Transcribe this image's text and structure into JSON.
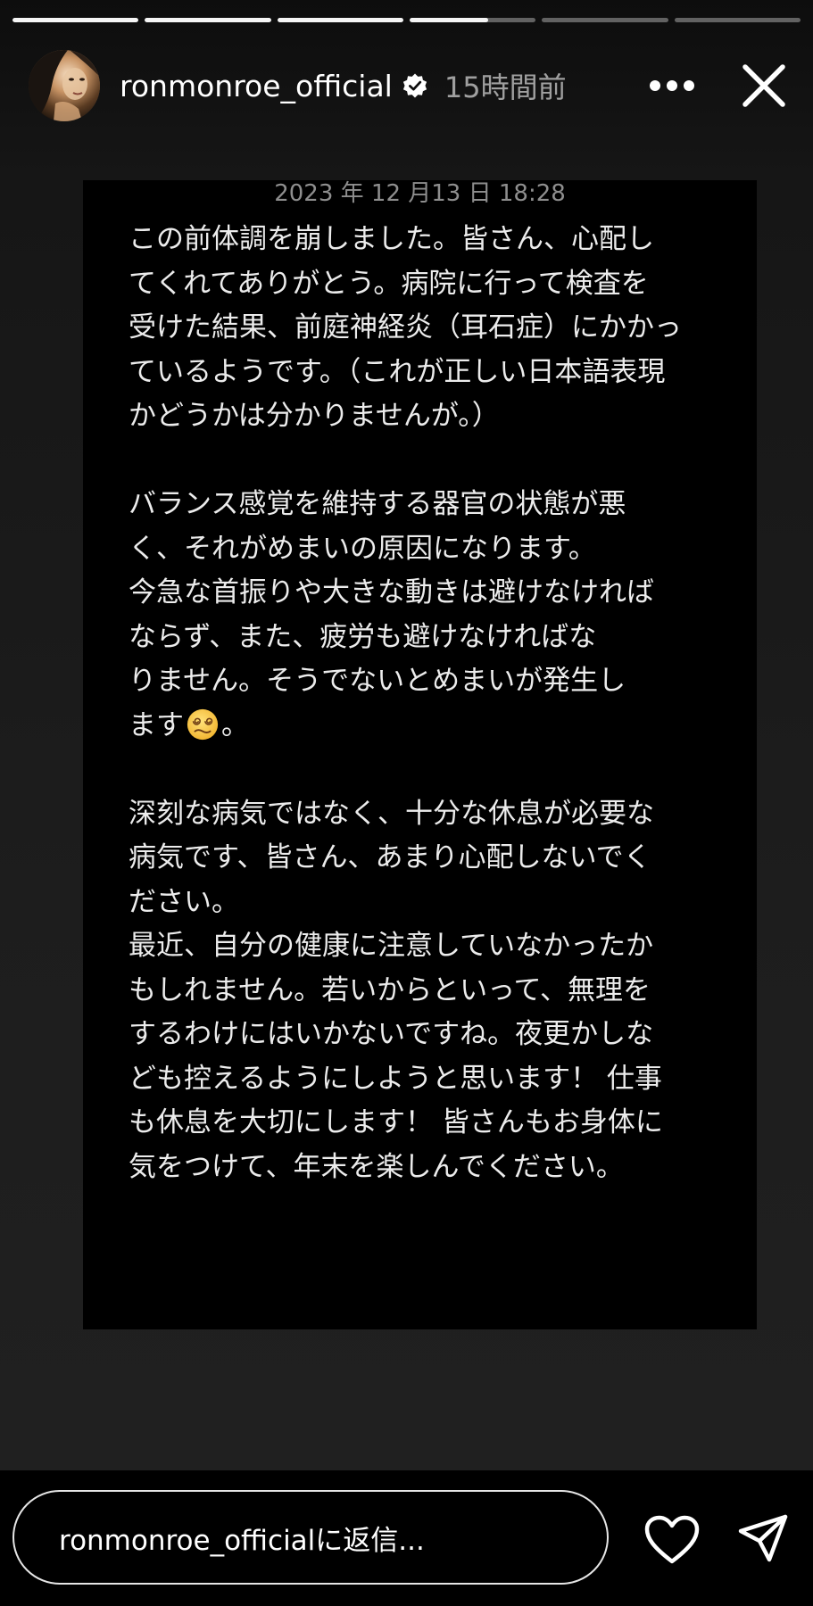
{
  "story": {
    "progress_segments": [
      1,
      1,
      1,
      0.62,
      0,
      0
    ]
  },
  "header": {
    "username": "ronmonroe_official",
    "time_ago": "15時間前",
    "verified": true,
    "icons": [
      "avatar",
      "verified-badge-icon",
      "more-icon",
      "close-icon"
    ]
  },
  "post": {
    "date": "2023 年 12 月13 日 18:28",
    "paragraphs": [
      {
        "lines": [
          "この前体調を崩しました。皆さん、心配し",
          "てくれてありがとう。病院に行って検査を",
          "受けた結果、前庭神経炎（耳石症）にかかっ",
          "ているようです。（これが正しい日本語表現",
          "かどうかは分かりませんが。）"
        ]
      },
      {
        "lines": [
          "バランス感覚を維持する器官の状態が悪",
          "く、それがめまいの原因になります。",
          "今急な首振りや大きな動きは避けなければ",
          "ならず、また、疲労も避けなければな",
          "りません。そうでないとめまいが発生し"
        ],
        "last_line_before_emoji": "ます",
        "last_line_after_emoji": "。",
        "emoji": "dizzy-face-emoji"
      },
      {
        "lines": [
          "深刻な病気ではなく、十分な休息が必要な",
          "病気です、皆さん、あまり心配しないでく",
          "ださい。",
          "最近、自分の健康に注意していなかったか",
          "もしれません。若いからといって、無理を",
          "するわけにはいかないですね。夜更かしな",
          "ども控えるようにしようと思います！ 仕事",
          "も休息を大切にします！ 皆さんもお身体に",
          "気をつけて、年末を楽しんでください。"
        ]
      }
    ]
  },
  "footer": {
    "reply_placeholder": "ronmonroe_officialに返信...",
    "icons": [
      "heart-icon",
      "send-icon"
    ]
  },
  "colors": {
    "background": "#1b1b1b",
    "card": "#000000",
    "text": "#ececec",
    "muted": "#8e8e8e"
  }
}
